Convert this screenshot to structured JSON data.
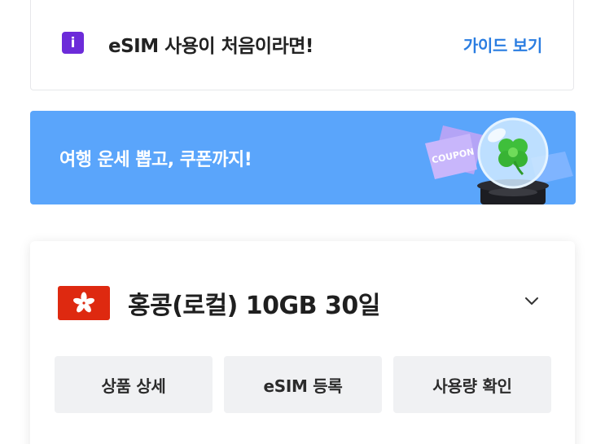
{
  "guide": {
    "badge": "i",
    "text": "eSIM 사용이 처음이라면!",
    "link": "가이드 보기",
    "badge_color": "#6c2bd9",
    "link_color": "#2a7de1"
  },
  "banner": {
    "text": "여행 운세 뽑고, 쿠폰까지!",
    "background": "#5aa5fb",
    "coupon_text": "COUPON",
    "art": "fortune-globe-clover-with-coupons"
  },
  "product": {
    "flag": "hong-kong-flag",
    "title": "홍콩(로컬) 10GB 30일",
    "toggle": "chevron-down-icon",
    "actions": [
      {
        "label": "상품 상세"
      },
      {
        "label": "eSIM 등록"
      },
      {
        "label": "사용량 확인"
      }
    ]
  }
}
